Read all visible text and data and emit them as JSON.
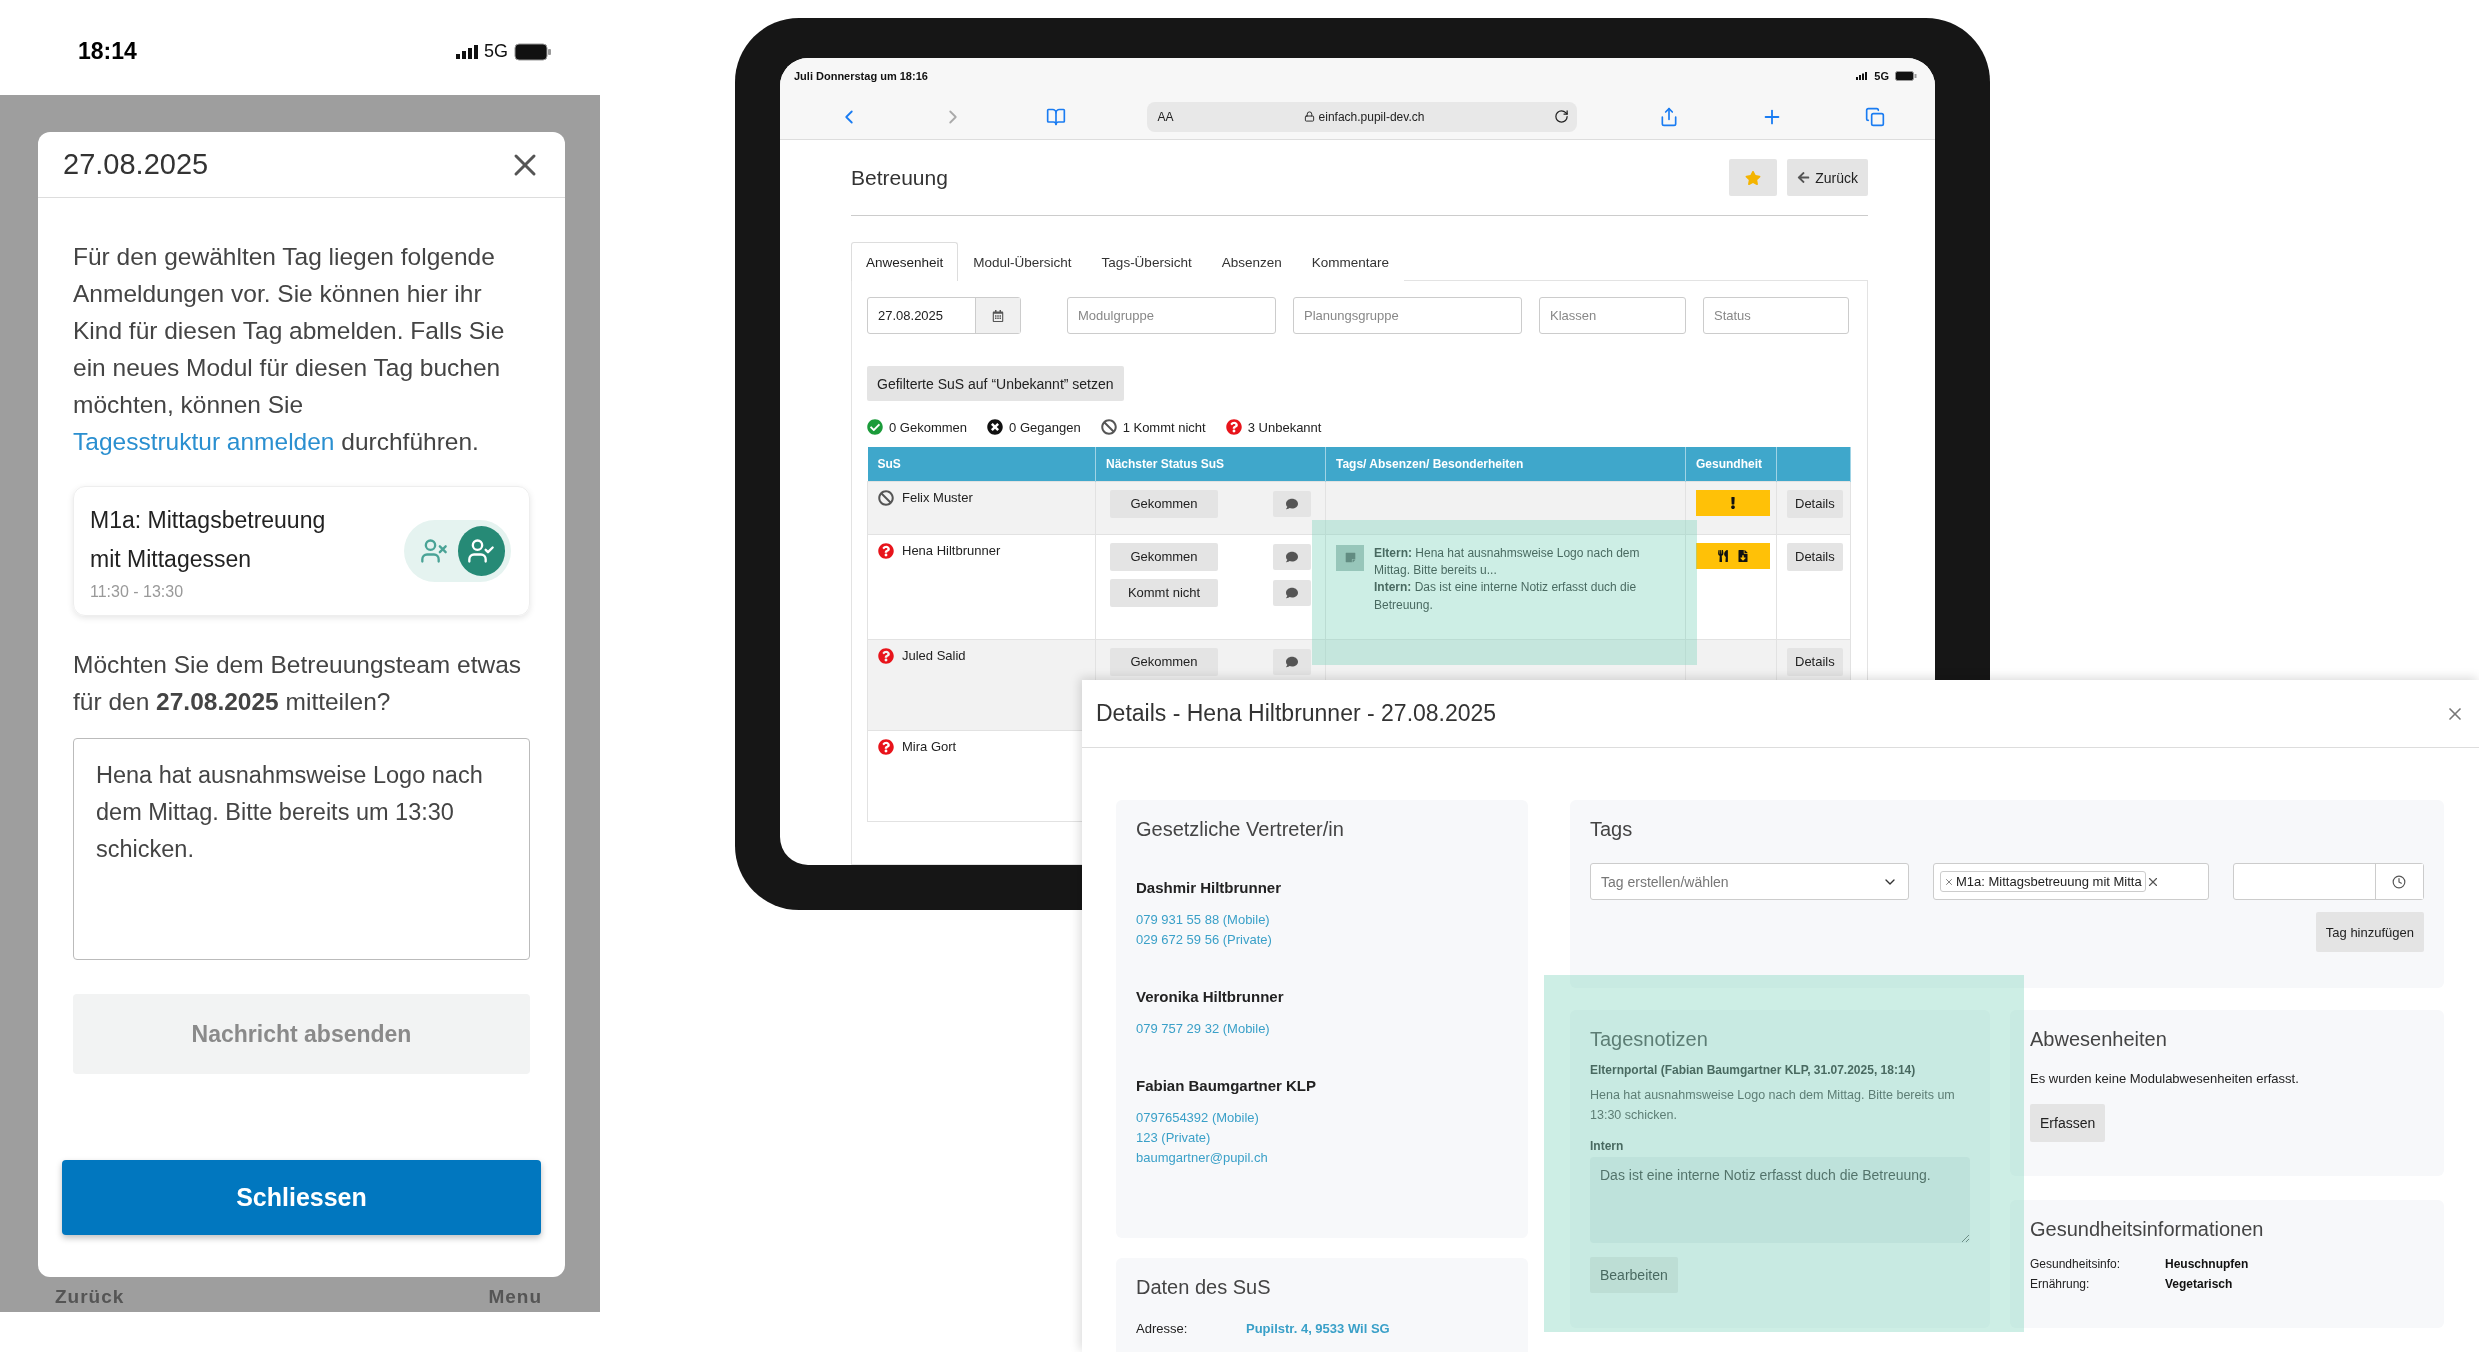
{
  "phone": {
    "status_bar": {
      "time": "18:14",
      "network": "5G"
    },
    "modal": {
      "title": "27.08.2025",
      "intro": {
        "before": "Für den gewählten Tag liegen folgende Anmeldungen vor. Sie können hier ihr Kind für diesen Tag abmelden. Falls Sie ein neues Modul für diesen Tag buchen möchten, können Sie ",
        "link": "Tagesstruktur anmelden",
        "after": " durchführen."
      },
      "module": {
        "title": "M1a: Mittagsbetreuung mit Mittagessen",
        "time": "11:30 - 13:30",
        "registered": true
      },
      "question": "Möchten Sie dem Betreuungsteam etwas für den **27.08.2025** mitteilen?",
      "message": "Hena hat ausnahmsweise Logo nach dem Mittag. Bitte bereits um 13:30 schicken.",
      "send_button": {
        "label": "Nachricht absenden",
        "disabled": true
      },
      "close_button": "Schliessen"
    },
    "nav": [
      "Zurück",
      "Menu"
    ]
  },
  "tablet": {
    "status_bar": {
      "time": "Juli Donnerstag um 18:16",
      "network": "5G"
    },
    "browser": {
      "text_size": "AA",
      "url": "einfach.pupil-dev.ch"
    },
    "page": {
      "title": "Betreuung",
      "favorite": true,
      "back_button": "Zurück",
      "tabs": [
        {
          "label": "Anwesenheit",
          "selected": true
        },
        {
          "label": "Modul-Übersicht",
          "selected": false
        },
        {
          "label": "Tags-Übersicht",
          "selected": false
        },
        {
          "label": "Absenzen",
          "selected": false
        },
        {
          "label": "Kommentare",
          "selected": false
        }
      ],
      "date": "27.08.2025",
      "filters": [
        {
          "placeholder": "Modulgruppe"
        },
        {
          "placeholder": "Planungsgruppe"
        },
        {
          "placeholder": "Klassen"
        },
        {
          "placeholder": "Status"
        }
      ],
      "reset_button": "Gefilterte SuS auf “Unbekannt” setzen",
      "legend": [
        {
          "kind": "arrived",
          "label": "0 Gekommen"
        },
        {
          "kind": "left",
          "label": "0 Gegangen"
        },
        {
          "kind": "not_coming",
          "label": "1 Kommt nicht"
        },
        {
          "kind": "unknown",
          "label": "3 Unbekannt"
        }
      ],
      "table": {
        "columns": [
          "SuS",
          "Nächster Status SuS",
          "Tags/ Absenzen/ Besonderheiten",
          "Gesundheit"
        ],
        "rows": [
          {
            "status": {
              "kind": "not_coming"
            },
            "name": "Felix Muster",
            "actions": [
              "Gekommen"
            ],
            "health": [
              {
                "kind": "alert"
              }
            ],
            "details": "Details"
          },
          {
            "status": {
              "kind": "unknown"
            },
            "name": "Hena Hiltbrunner",
            "actions": [
              "Gekommen",
              "Kommt nicht"
            ],
            "notes": [
              "**Eltern:** Hena hat ausnahmsweise Logo nach dem Mittag. Bitte bereits u...",
              "**Intern:** Das ist eine interne Notiz erfasst duch die Betreuung."
            ],
            "health": [
              {
                "kind": "meal"
              },
              {
                "kind": "document"
              }
            ],
            "details": "Details"
          },
          {
            "status": {
              "kind": "unknown"
            },
            "name": "Juled Salid",
            "actions": [
              "Gekommen"
            ],
            "details": "Details"
          },
          {
            "status": {
              "kind": "unknown"
            },
            "name": "Mira Gort"
          }
        ]
      }
    }
  },
  "details": {
    "title": "Details - Hena Hiltbrunner - 27.08.2025",
    "representatives": {
      "heading": "Gesetzliche Vertreter/in",
      "contacts": [
        {
          "name": "Dashmir Hiltbrunner",
          "lines": [
            "079 931 55 88 (Mobile)",
            "029 672 59 56 (Private)"
          ]
        },
        {
          "name": "Veronika Hiltbrunner",
          "lines": [
            "079 757 29 32 (Mobile)"
          ]
        },
        {
          "name": "Fabian Baumgartner KLP",
          "lines": [
            "0797654392 (Mobile)",
            "123 (Private)",
            "baumgartner@pupil.ch"
          ]
        }
      ]
    },
    "student": {
      "heading": "Daten des SuS",
      "rows": [
        {
          "label": "Adresse:",
          "value": "Pupilstr. 4, 9533 Wil SG"
        }
      ]
    },
    "tags": {
      "heading": "Tags",
      "select_placeholder": "Tag erstellen/wählen",
      "chip": "M1a: Mittagsbetreuung mit Mitta",
      "add_button": "Tag hinzufügen"
    },
    "notes": {
      "heading": "Tagesnotizen",
      "author": "Elternportal (Fabian Baumgartner KLP, 31.07.2025, 18:14)",
      "text": "Hena hat ausnahmsweise Logo nach dem Mittag. Bitte bereits um 13:30 schicken.",
      "intern_label": "Intern",
      "intern_text": "Das ist eine interne Notiz erfasst duch die Betreuung.",
      "edit_button": "Bearbeiten"
    },
    "absences": {
      "heading": "Abwesenheiten",
      "text": "Es wurden keine Modulabwesenheiten erfasst.",
      "button": "Erfassen"
    },
    "health": {
      "heading": "Gesundheitsinformationen",
      "rows": [
        {
          "label": "Gesundheitsinfo:",
          "value": "Heuschnupfen"
        },
        {
          "label": "Ernährung:",
          "value": "Vegetarisch"
        }
      ]
    }
  }
}
